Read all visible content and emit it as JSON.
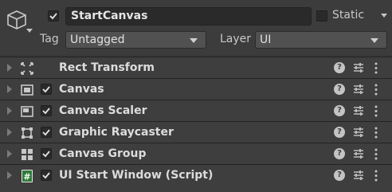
{
  "object": {
    "name": "StartCanvas",
    "active": true,
    "static_label": "Static",
    "static_checked": false,
    "tag_label": "Tag",
    "tag_value": "Untagged",
    "layer_label": "Layer",
    "layer_value": "UI",
    "icon": "gameobject-cube-icon"
  },
  "components": [
    {
      "title": "Rect Transform",
      "icon": "rect-transform-icon",
      "has_checkbox": false
    },
    {
      "title": "Canvas",
      "icon": "canvas-icon",
      "has_checkbox": true,
      "enabled": true
    },
    {
      "title": "Canvas Scaler",
      "icon": "canvas-scaler-icon",
      "has_checkbox": true,
      "enabled": true
    },
    {
      "title": "Graphic Raycaster",
      "icon": "graphic-raycaster-icon",
      "has_checkbox": true,
      "enabled": true
    },
    {
      "title": "Canvas Group",
      "icon": "canvas-group-icon",
      "has_checkbox": true,
      "enabled": true
    },
    {
      "title": "UI Start Window (Script)",
      "icon": "script-icon",
      "has_checkbox": true,
      "enabled": true
    }
  ],
  "component_actions": {
    "help_glyph": "?",
    "icons": [
      "help-icon",
      "presets-icon",
      "kebab-menu-icon"
    ]
  },
  "colors": {
    "background": "#383838",
    "header": "#3c3c3c",
    "component_row": "#3e3e3e",
    "text": "#d2d2d2",
    "script_icon_green": "#2f7a3a"
  }
}
